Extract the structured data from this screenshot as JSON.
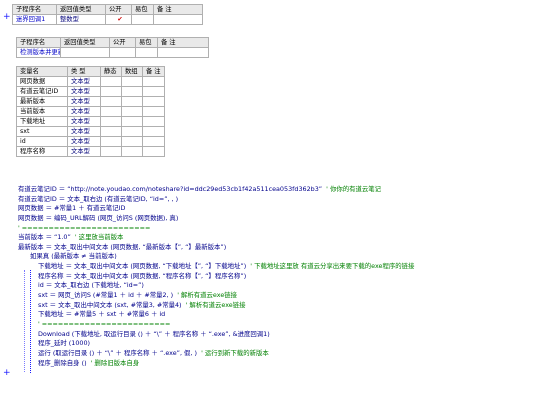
{
  "sub1": {
    "headers": [
      "子程序名",
      "返回值类型",
      "公开",
      "易包",
      "备 注"
    ],
    "row": {
      "name": "迷界回调1",
      "ret": "整数型",
      "public": "✔",
      "pkg": "",
      "note": ""
    }
  },
  "sub2": {
    "headers": [
      "子程序名",
      "返回值类型",
      "公开",
      "易包",
      "备 注"
    ],
    "row": {
      "name": "检测版本并更新"
    }
  },
  "vars": {
    "headers": [
      "变量名",
      "类 型",
      "静态",
      "数组",
      "备 注"
    ],
    "rows": [
      {
        "name": "网页数据",
        "type": "文本型"
      },
      {
        "name": "有道云笔记ID",
        "type": "文本型"
      },
      {
        "name": "最新版本",
        "type": "文本型"
      },
      {
        "name": "当前版本",
        "type": "文本型"
      },
      {
        "name": "下载地址",
        "type": "文本型"
      },
      {
        "name": "sxt",
        "type": "文本型"
      },
      {
        "name": "id",
        "type": "文本型"
      },
      {
        "name": "程序名称",
        "type": "文本型"
      }
    ]
  },
  "code": {
    "l1a": "有道云笔记ID ＝ “http://note.youdao.com/noteshare?id=ddc29ed53cb1f42a511cea053fd362b3”",
    "l1c": "' 你你的有道云笔记",
    "l2a": "有道云笔记ID ＝ 文本_取右边 (有道云笔记ID, “id=”, , )",
    "l3a": "网页数据 ＝ #常量1 ＋ 有道云笔记ID",
    "l4a": "网页数据 ＝ 编码_URL解码 (网页_访问S (网页数据), 真)",
    "l5": "' ========================",
    "l6a": "当前版本 ＝ “1.0”",
    "l6c": "' 这里放当前版本",
    "l7a": "最新版本 ＝ 文本_取出中间文本 (网页数据, “最新版本【”, “】最新版本”)",
    "l8a": "如果真 (最新版本 ≠ 当前版本)",
    "l9a": "下载地址 ＝ 文本_取出中间文本 (网页数据, “下载地址【”, “】下载地址”)",
    "l9c": "' 下载地址这里放 有道云分享出来要下载的exe程序的链接",
    "l10a": "程序名称 ＝ 文本_取出中间文本 (网页数据, “程序名称【”, “】程序名称”)",
    "l11a": "id ＝ 文本_取右边 (下载地址, “id=”)",
    "l12a": "sxt ＝ 网页_访问S (#常量1 ＋ id ＋ #常量2, )",
    "l12c": "' 解析有道云exe链接",
    "l13a": "sxt ＝ 文本_取出中间文本 (sxt, #常量3, #常量4)",
    "l13c": "' 解析有道云exe链接",
    "l14a": "下载地址 ＝ #常量5 ＋ sxt ＋ #常量6 ＋ id",
    "l15": "' ========================",
    "l16a": "Download (下载地址, 取运行目录 () ＋ “\\” ＋ 程序名称 ＋ “.exe”, &进度回调1)",
    "l17a": "程序_延时 (1000)",
    "l18a": "运行 (取运行目录 () ＋ “\\” ＋ 程序名称 ＋ “.exe”, 假, )",
    "l18c": "' 运行到新下载的新版本",
    "l19a": "程序_删除自身 ()",
    "l19c": "' 删除旧版本自身"
  }
}
